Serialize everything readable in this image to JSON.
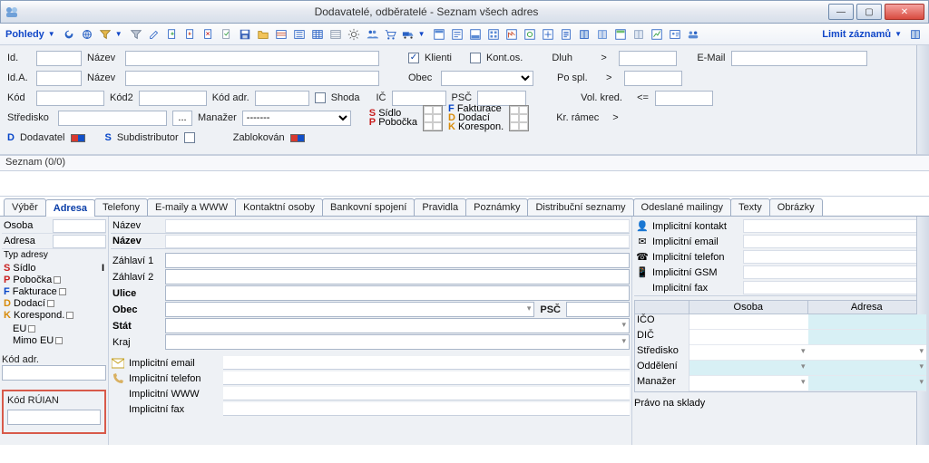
{
  "window": {
    "title": "Dodavatelé, odběratelé - Seznam všech adres"
  },
  "toolbar": {
    "views_label": "Pohledy",
    "limit_label": "Limit záznamů"
  },
  "filter": {
    "id_label": "Id.",
    "nazev_label": "Název",
    "ida_label": "Id.A.",
    "nazev2_label": "Název",
    "obec_label": "Obec",
    "klienti_label": "Klienti",
    "kontos_label": "Kont.os.",
    "dluh_label": "Dluh",
    "dluh_op": ">",
    "po_spl_label": "Po spl.",
    "po_spl_op": ">",
    "volkred_label": "Vol. kred.",
    "volkred_op": "<=",
    "kr_ramec_label": "Kr. rámec",
    "kr_ramec_op": ">",
    "email_label": "E-Mail",
    "kod_label": "Kód",
    "kod2_label": "Kód2",
    "kodadr_label": "Kód adr.",
    "shoda_label": "Shoda",
    "ic_label": "IČ",
    "psc_label": "PSČ",
    "stredisko_label": "Středisko",
    "manazer_label": "Manažer",
    "manazer_value": "-------",
    "sidlo_label": "Sídlo",
    "pobocka_label": "Pobočka",
    "fakturace_label": "Fakturace",
    "dodaci_label": "Dodací",
    "korespon_label": "Korespon.",
    "s_prefix": "S",
    "p_prefix": "P",
    "f_prefix": "F",
    "d_prefix": "D",
    "k_prefix": "K",
    "dodavatel_label": "Dodavatel",
    "subdistributor_label": "Subdistributor",
    "zablokovan_label": "Zablokován"
  },
  "strip": {
    "seznam_label": "Seznam (0/0)"
  },
  "tabs": {
    "items": [
      "Výběr",
      "Adresa",
      "Telefony",
      "E-maily a WWW",
      "Kontaktní osoby",
      "Bankovní spojení",
      "Pravidla",
      "Poznámky",
      "Distribuční seznamy",
      "Odeslané mailingy",
      "Texty",
      "Obrázky"
    ],
    "active_index": 1
  },
  "detail_left": {
    "osoba_label": "Osoba",
    "adresa_label": "Adresa",
    "typ_adresy_label": "Typ adresy",
    "sidlo": "Sídlo",
    "pobocka": "Pobočka",
    "fakturace": "Fakturace",
    "dodaci": "Dodací",
    "korespond": "Korespond.",
    "eu": "EU",
    "mimo_eu": "Mimo EU",
    "kod_adr_label": "Kód adr.",
    "kod_ruian_label": "Kód RÚIAN"
  },
  "detail_mid": {
    "nazev_label": "Název",
    "nazev_bold": "Název",
    "zahlavi1_label": "Záhlaví 1",
    "zahlavi2_label": "Záhlaví 2",
    "ulice_label": "Ulice",
    "obec_label": "Obec",
    "psc_label": "PSČ",
    "stat_label": "Stát",
    "kraj_label": "Kraj",
    "imp_email": "Implicitní email",
    "imp_telefon": "Implicitní telefon",
    "imp_www": "Implicitní WWW",
    "imp_fax": "Implicitní fax"
  },
  "detail_right": {
    "imp_kontakt": "Implicitní kontakt",
    "imp_email": "Implicitní email",
    "imp_telefon": "Implicitní telefon",
    "imp_gsm": "Implicitní GSM",
    "imp_fax": "Implicitní fax",
    "osoba_hdr": "Osoba",
    "adresa_hdr": "Adresa",
    "ico": "IČO",
    "dic": "DIČ",
    "stredisko": "Středisko",
    "oddeleni": "Oddělení",
    "manazer": "Manažer",
    "pravo": "Právo na sklady"
  }
}
